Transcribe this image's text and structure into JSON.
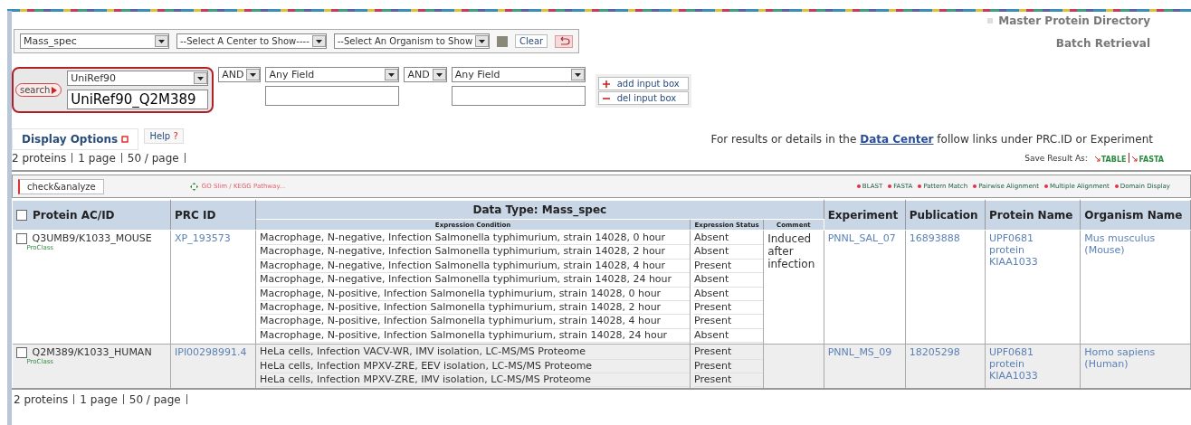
{
  "header": {
    "title": "Master Protein Directory",
    "subtitle": "Batch Retrieval"
  },
  "filters": {
    "selects": [
      "Mass_spec",
      "--Select A Center to Show----",
      "--Select An Organism to Show"
    ],
    "clear": "Clear"
  },
  "query": {
    "search": "search",
    "highlighted": true,
    "fields": [
      {
        "field": "UniRef90",
        "value": "UniRef90_Q2M389"
      },
      {
        "operator": "AND",
        "field": "Any Field"
      },
      {
        "operator": "AND",
        "field": "Any Field"
      }
    ],
    "add": "add input box",
    "del": "del input box"
  },
  "tabs": [
    {
      "label": "Display Options",
      "selected": true
    },
    {
      "label": "Help",
      "mark": "?",
      "selected": false
    }
  ],
  "info": {
    "before": "For results or details in the",
    "link": "Data Center",
    "after": "follow links under PRC.ID or Experiment"
  },
  "summary_top": [
    "2 proteins",
    "1 page",
    "50 / page"
  ],
  "save": {
    "label": "Save Result As:",
    "options": [
      "TABLE",
      "FASTA"
    ]
  },
  "toolbar": {
    "check_analyze": "check&analyze",
    "pathway": "GO Slim / KEGG Pathway...",
    "tools": [
      "BLAST",
      "FASTA",
      "Pattern Match",
      "Pairwise Alignment",
      "Multiple Alignment",
      "Domain Display"
    ]
  },
  "table": {
    "header_checked": false,
    "group_title": "Data Type: Mass_spec",
    "columns": [
      "Protein AC/ID",
      "PRC ID",
      "Experiment",
      "Publication",
      "Protein Name",
      "Organism Name"
    ],
    "subcolumns": [
      "Expression Condition",
      "Expression Status",
      "Comment"
    ],
    "rows": [
      {
        "protein": "Q3UMB9/K1033_MOUSE",
        "checked": false,
        "source": "ProClass",
        "prc": "XP_193573",
        "conditions": [
          {
            "condition": "Macrophage, N-negative, Infection Salmonella typhimurium, strain 14028, 0 hour",
            "status": "Absent"
          },
          {
            "condition": "Macrophage, N-negative, Infection Salmonella typhimurium, strain 14028, 2 hour",
            "status": "Absent"
          },
          {
            "condition": "Macrophage, N-negative, Infection Salmonella typhimurium, strain 14028, 4 hour",
            "status": "Present"
          },
          {
            "condition": "Macrophage, N-negative, Infection Salmonella typhimurium, strain 14028, 24 hour",
            "status": "Absent"
          },
          {
            "condition": "Macrophage, N-positive, Infection Salmonella typhimurium, strain 14028, 0 hour",
            "status": "Absent"
          },
          {
            "condition": "Macrophage, N-positive, Infection Salmonella typhimurium, strain 14028, 2 hour",
            "status": "Present"
          },
          {
            "condition": "Macrophage, N-positive, Infection Salmonella typhimurium, strain 14028, 4 hour",
            "status": "Present"
          },
          {
            "condition": "Macrophage, N-positive, Infection Salmonella typhimurium, strain 14028, 24 hour",
            "status": "Absent"
          }
        ],
        "comment": "Induced after infection",
        "experiment": "PNNL_SAL_07",
        "publication": "16893888",
        "protein_name": "UPF0681 protein KIAA1033",
        "organism": "Mus musculus (Mouse)"
      },
      {
        "protein": "Q2M389/K1033_HUMAN",
        "checked": false,
        "source": "ProClass",
        "prc": "IPI00298991.4",
        "conditions": [
          {
            "condition": "HeLa cells, Infection VACV-WR, IMV isolation, LC-MS/MS Proteome",
            "status": "Present"
          },
          {
            "condition": "HeLa cells, Infection MPXV-ZRE, EEV isolation, LC-MS/MS Proteome",
            "status": "Present"
          },
          {
            "condition": "HeLa cells, Infection MPXV-ZRE, IMV isolation, LC-MS/MS Proteome",
            "status": "Present"
          }
        ],
        "experiment": "PNNL_MS_09",
        "publication": "18205298",
        "protein_name": "UPF0681 protein KIAA1033",
        "organism": "Homo sapiens (Human)"
      }
    ]
  },
  "summary_bottom": [
    "2 proteins",
    "1 page",
    "50 / page"
  ]
}
